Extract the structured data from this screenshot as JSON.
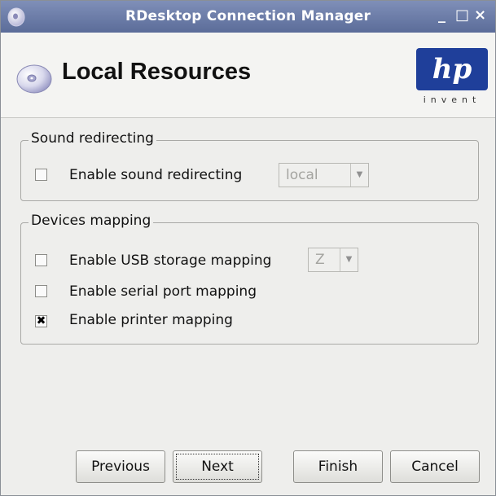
{
  "window": {
    "title": "RDesktop Connection Manager",
    "controls": {
      "minimize": "_",
      "maximize": "□",
      "close": "×"
    }
  },
  "header": {
    "title": "Local Resources",
    "logo_text": "hp",
    "logo_tagline": "invent",
    "logo_color": "#1f3f9a"
  },
  "sound_group": {
    "legend": "Sound redirecting",
    "enable_label": "Enable sound redirecting",
    "enable_checked": false,
    "combo_value": "local"
  },
  "devices_group": {
    "legend": "Devices mapping",
    "usb_label": "Enable USB storage mapping",
    "usb_checked": false,
    "usb_combo_value": "Z",
    "serial_label": "Enable serial port mapping",
    "serial_checked": false,
    "printer_label": "Enable printer mapping",
    "printer_checked": true,
    "check_mark": "✖"
  },
  "buttons": {
    "previous": "Previous",
    "next": "Next",
    "finish": "Finish",
    "cancel": "Cancel"
  },
  "colors": {
    "titlebar": "#6878a8",
    "background": "#eeeeec"
  }
}
